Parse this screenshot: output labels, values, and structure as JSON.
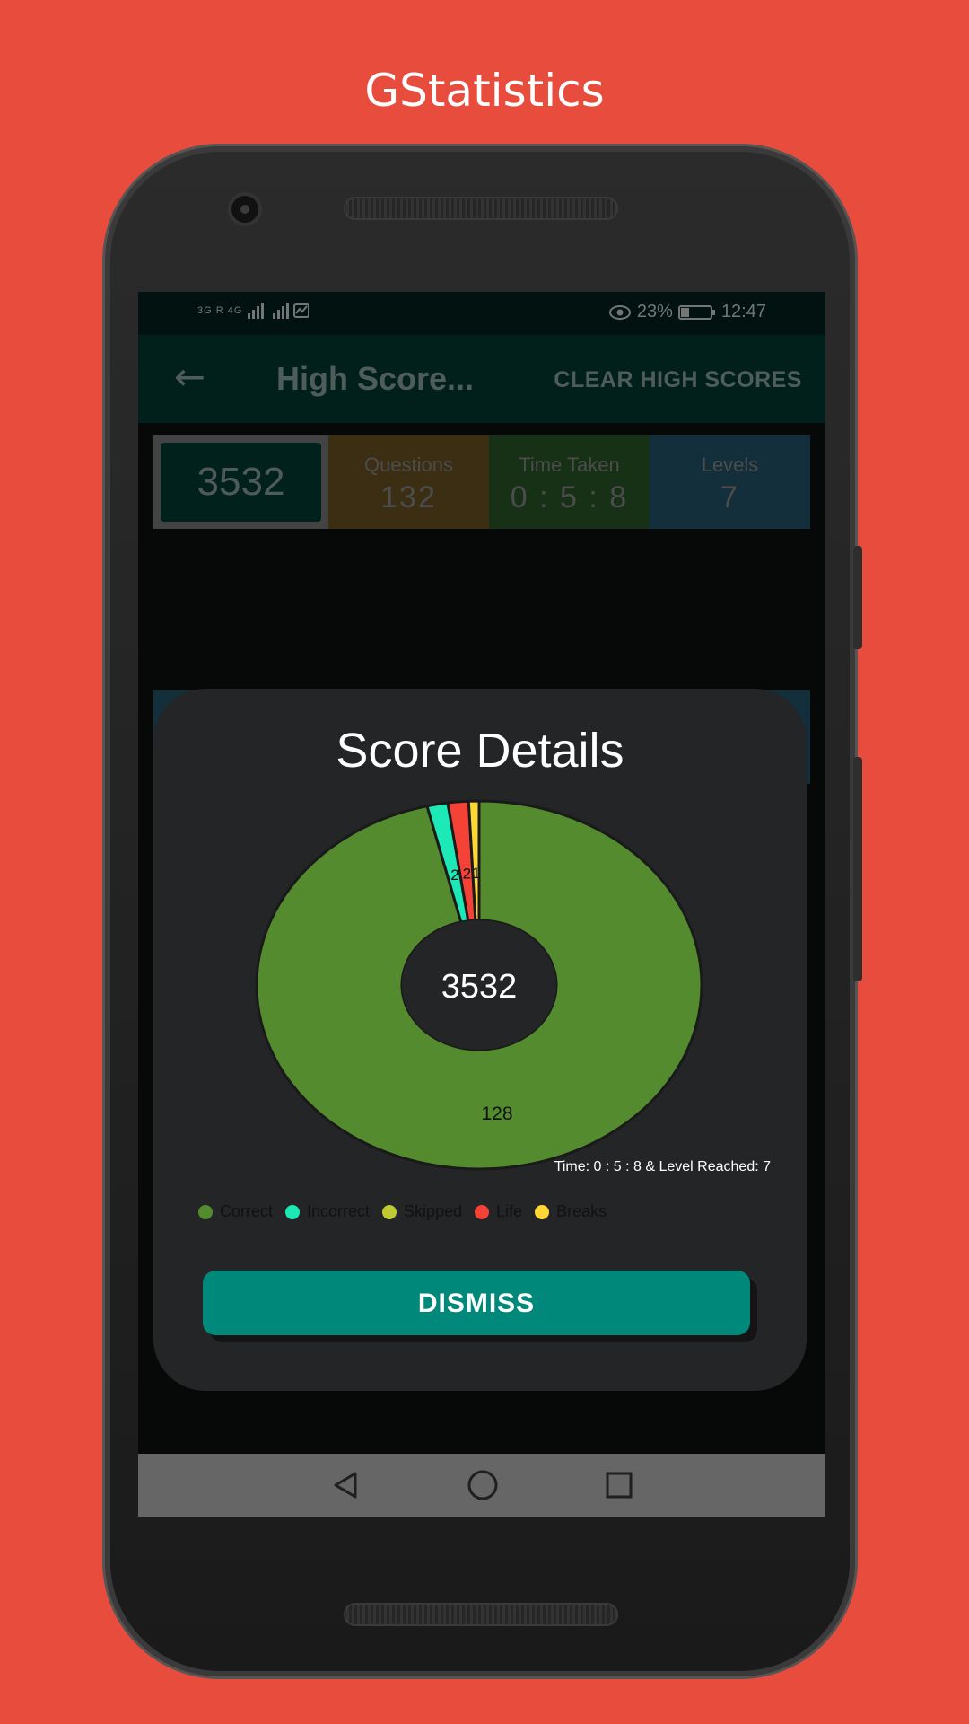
{
  "promo": {
    "title": "GStatistics"
  },
  "statusbar": {
    "signal_text": "3G R 4G",
    "battery": "23%",
    "time": "12:47"
  },
  "toolbar": {
    "title": "High Score...",
    "action": "CLEAR HIGH SCORES"
  },
  "score_row": {
    "score": "3532",
    "questions_label": "Questions",
    "questions_value": "132",
    "time_label": "Time Taken",
    "time_value": "0 : 5 : 8",
    "levels_label": "Levels",
    "levels_value": "7"
  },
  "dialog": {
    "title": "Score Details",
    "center_text": "3532",
    "caption": "Time: 0 : 5 : 8 & Level Reached: 7",
    "dismiss_label": "DISMISS"
  },
  "colors": {
    "background": "#e84c3d",
    "correct": "#548b2f",
    "incorrect": "#1de9b6",
    "skipped": "#c0ca33",
    "life": "#f44336",
    "breaks": "#fdd835",
    "accent": "#00887a"
  },
  "chart_data": {
    "type": "pie",
    "labels": [
      "Correct",
      "Incorrect",
      "Skipped",
      "Life",
      "Breaks"
    ],
    "values": [
      128,
      2,
      0,
      2,
      1
    ],
    "center_label": "3532",
    "legend_position": "bottom"
  }
}
